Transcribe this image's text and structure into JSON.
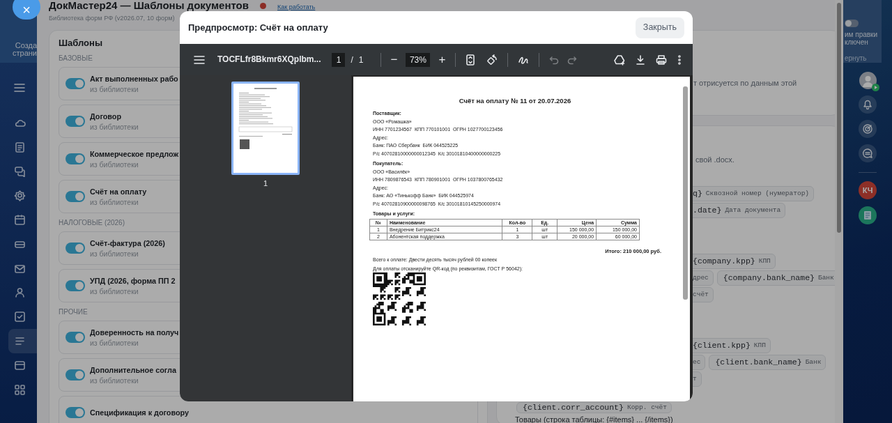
{
  "left_menu": {
    "create_label": [
      "Созда",
      "страни"
    ],
    "items": [
      {
        "selected": false
      },
      {
        "selected": false
      },
      {
        "selected": false
      },
      {
        "selected": false
      },
      {
        "selected": false
      },
      {
        "selected": false
      },
      {
        "selected": false
      },
      {
        "selected": false
      },
      {
        "selected": false
      },
      {
        "selected": true
      },
      {
        "selected": false
      },
      {
        "selected": false
      }
    ]
  },
  "close_panel": "×",
  "page": {
    "title": "ДокМастер24 — Шаблоны документов",
    "help_link": "Как работать",
    "subtitle": "Библиотека форм РФ (v2026.07, 10 форм)",
    "templates": {
      "title": "Шаблоны",
      "groups": [
        {
          "label": "БАЗОВЫЕ",
          "items": [
            {
              "name": "Акт выполненных рабо",
              "source": "из библиотеки",
              "on": true
            },
            {
              "name": "Договор",
              "source": "из библиотеки",
              "on": true
            },
            {
              "name": "Коммерческое предлож",
              "source": "из библиотеки",
              "on": true
            },
            {
              "name": "Счёт на оплату",
              "source": "из библиотеки",
              "on": true
            }
          ]
        },
        {
          "label": "НАЛОГОВЫЕ (2026)",
          "items": [
            {
              "name": "Счёт-фактура (2026)",
              "source": "из библиотеки",
              "on": true
            },
            {
              "name": "УПД (2026, форма ПП 2",
              "source": "из библиотеки",
              "on": true
            }
          ]
        },
        {
          "label": "ПРОЧИЕ",
          "items": [
            {
              "name": "Доверенность на получ",
              "source": "из библиотеки",
              "on": true
            },
            {
              "name": "Дополнительное согла",
              "source": "из библиотеки",
              "on": true
            },
            {
              "name": "Спецификация к договору",
              "on": true
            }
          ]
        }
      ]
    },
    "preview_card": {
      "text": "т отрисуется по данным этой"
    },
    "fields_card": {
      "intro": "свой .docx.",
      "groups": [
        [
          [
            {
              "code": "q}",
              "hint": "Сквозной номер (нумератор)"
            }
          ],
          [
            {
              "code": ".date}",
              "hint": "Дата документа"
            }
          ]
        ],
        [
          [
            {
              "code": "{company.kpp}",
              "hint": "КПП"
            }
          ],
          [
            {
              "hint": "дрес"
            },
            {
              "code": "{company.bank_name}",
              "hint": "Банк"
            }
          ],
          [
            {
              "hint": "счёт"
            }
          ]
        ],
        [
          [
            {
              "code": "{client.kpp}",
              "hint": "КПП"
            }
          ],
          [
            {
              "hint": "ес"
            },
            {
              "code": "{client.bank_name}",
              "hint": "Банк"
            }
          ],
          [
            {
              "hint": "т"
            }
          ]
        ]
      ],
      "last_chip": {
        "code": "{client.corr_account}",
        "hint": "Корр. счёт"
      },
      "footer": "Товары (строка таблицы: {#items} ... {/items})"
    }
  },
  "edit_mode": {
    "on": false,
    "lines": [
      "им правки",
      "ключен"
    ],
    "link": "ернуть"
  },
  "user_initials": "КЧ",
  "modal": {
    "title": "Предпросмотр: Счёт на оплату",
    "close": "Закрыть",
    "viewer": {
      "file_name": "TOCFLfr8Bkmr6XQplbm...",
      "page": "1",
      "page_separator": "/",
      "page_count": "1",
      "zoom": "73%",
      "minus": "−",
      "plus": "+",
      "undo_disabled": true,
      "redo_disabled": true,
      "thumbnail": {
        "label": "1",
        "selected": true
      },
      "document": {
        "title": "Счёт на оплату № 11 от 20.07.2026",
        "parties": [
          {
            "heading": "Поставщик:",
            "lines": [
              "ООО «Ромашка»",
              "ИНН 7701234567  КПП 770101001  ОГРН 1027700123456",
              "Адрес:",
              "Банк: ПАО Сбербанк  БИК 044525225",
              "Р/с 40702810000000012345  К/с 30101810400000000225"
            ]
          },
          {
            "heading": "Покупатель:",
            "lines": [
              "ООО «Василёк»",
              "ИНН 7809876543  КПП 780901001  ОГРН 1037800765432",
              "Адрес:",
              "Банк: АО «Тинькофф Банк»  БИК 044525974",
              "Р/с 40702810900000098765  К/с 30101810145250000974"
            ]
          }
        ],
        "items_heading": "Товары и услуги:",
        "table": {
          "columns": [
            "№",
            "Наименование",
            "Кол-во",
            "Ед.",
            "Цена",
            "Сумма"
          ],
          "rows": [
            [
              "1",
              "Внедрение Битрикс24",
              "1",
              "шт",
              "150 000,00",
              "150 000,00"
            ],
            [
              "2",
              "Абонентская поддержка",
              "3",
              "шт",
              "20 000,00",
              "60 000,00"
            ]
          ]
        },
        "total": "Итого: 210 000,00 руб.",
        "amount_words": "Всего к оплате: Двести десять тысяч рублей 00 копеек",
        "qr_caption": "Для оплаты отсканируйте QR-код (по реквизитам, ГОСТ Р 56042):"
      }
    }
  }
}
